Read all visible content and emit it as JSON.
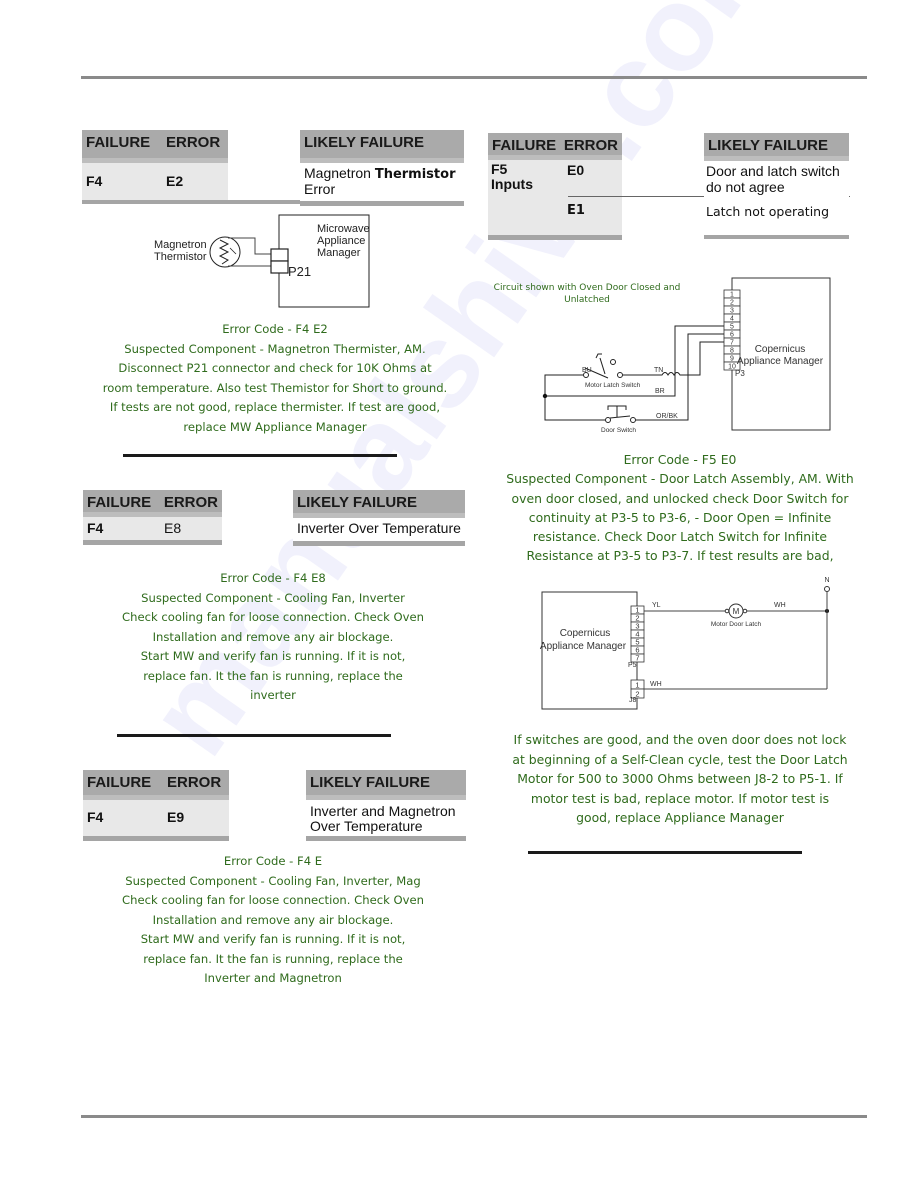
{
  "watermark": "manualshive.com",
  "sections": {
    "f4e2": {
      "table": {
        "failure_header": "FAILURE",
        "error_header": "ERROR",
        "likely_header": "LIKELY FAILURE",
        "failure": "F4",
        "error": "E2",
        "likely_line1_a": "Magnetron ",
        "likely_line1_b": "Thermistor",
        "likely_line2": "Error"
      },
      "diagram": {
        "thermistor_label_1": "Magnetron",
        "thermistor_label_2": "Thermistor",
        "manager_label_1": "Microwave",
        "manager_label_2": "Appliance",
        "manager_label_3": "Manager",
        "connector": "P21"
      },
      "notes": [
        "Error Code - F4 E2",
        "Suspected Component - Magnetron Thermister,  AM.",
        "Disconnect P21 connector and check for 10K Ohms at",
        "room temperature. Also test Themistor for Short to ground.",
        "If tests are not good,  replace thermister.  If test are good,",
        "replace MW Appliance Manager"
      ]
    },
    "f4e8": {
      "table": {
        "failure_header": "FAILURE",
        "error_header": "ERROR",
        "likely_header": "LIKELY FAILURE",
        "failure": "F4",
        "error": "E8",
        "likely": "Inverter Over Temperature"
      },
      "notes": [
        "Error Code - F4 E8",
        "Suspected Component - Cooling Fan, Inverter",
        "Check cooling fan for loose connection. Check Oven",
        "Installation and remove any air blockage.",
        "Start MW and verify fan is running.  If it is not,",
        "replace fan.  It the fan is running, replace the",
        "inverter"
      ]
    },
    "f4e9": {
      "table": {
        "failure_header": "FAILURE",
        "error_header": "ERROR",
        "likely_header": "LIKELY FAILURE",
        "failure": "F4",
        "error": "E9",
        "likely_line1": "Inverter and Magnetron",
        "likely_line2": "Over Temperature"
      },
      "notes": [
        "Error Code - F4 E",
        "Suspected Component - Cooling Fan, Inverter, Mag",
        "Check cooling fan for loose connection. Check Oven",
        "Installation and remove any air blockage.",
        "Start MW and verify fan is running.  If it is not,",
        "replace fan.  It the fan is running, replace the",
        "Inverter and Magnetron"
      ]
    },
    "f5": {
      "table": {
        "failure_header": "FAILURE",
        "error_header": "ERROR",
        "likely_header": "LIKELY FAILURE",
        "failure_line1": "F5",
        "failure_line2": "Inputs",
        "error_1": "E0",
        "error_2": "E1",
        "likely_1_line1": "Door and latch switch",
        "likely_1_line2": "do not agree",
        "likely_2": "Latch not operating"
      },
      "circuit1": {
        "caption_1": "Circuit shown with Oven Door Closed and",
        "caption_2": "Unlatched",
        "pins": [
          "1",
          "2",
          "3",
          "4",
          "5",
          "6",
          "7",
          "8",
          "9",
          "10"
        ],
        "connector": "P3",
        "manager_label_1": "Copernicus",
        "manager_label_2": "Appliance Manager",
        "wire_bu": "BU",
        "wire_tn": "TN",
        "wire_br": "BR",
        "wire_orbk": "OR/BK",
        "motor_latch_switch": "Motor Latch Switch",
        "door_switch": "Door Switch"
      },
      "notes": [
        "Error Code -  F5 E0",
        "Suspected Component - Door Latch Assembly, AM.  With",
        "oven door closed, and unlocked check Door Switch for",
        "continuity  at P3-5 to P3-6, - Door Open = Infinite",
        "resistance. Check Door Latch Switch for Infinite",
        "Resistance at P3-5 to P3-7. If test results are bad,"
      ],
      "circuit2": {
        "manager_label_1": "Copernicus",
        "manager_label_2": "Appliance Manager",
        "p5_pins": [
          "1",
          "2",
          "3",
          "4",
          "5",
          "6",
          "7"
        ],
        "p5": "P5",
        "j8_pins": [
          "1",
          "2"
        ],
        "j8": "J8",
        "wire_yl": "YL",
        "wire_wh_top": "WH",
        "wire_wh_bottom": "WH",
        "motor_label": "Motor Door Latch",
        "motor_symbol": "M",
        "neutral": "N"
      },
      "notes2": [
        "If switches are good, and the oven door does not lock",
        "at beginning of a Self-Clean cycle, test the Door Latch",
        "Motor for 500 to 3000 Ohms between J8-2 to P5-1.  If",
        "motor test is bad, replace motor.  If motor test is",
        "good, replace Appliance Manager"
      ]
    }
  },
  "colors": {
    "note_text": "#2f6b1c",
    "table_header": "#aaaaaa",
    "table_body": "#e8e8e8",
    "page_rule": "#8a8a8a"
  }
}
